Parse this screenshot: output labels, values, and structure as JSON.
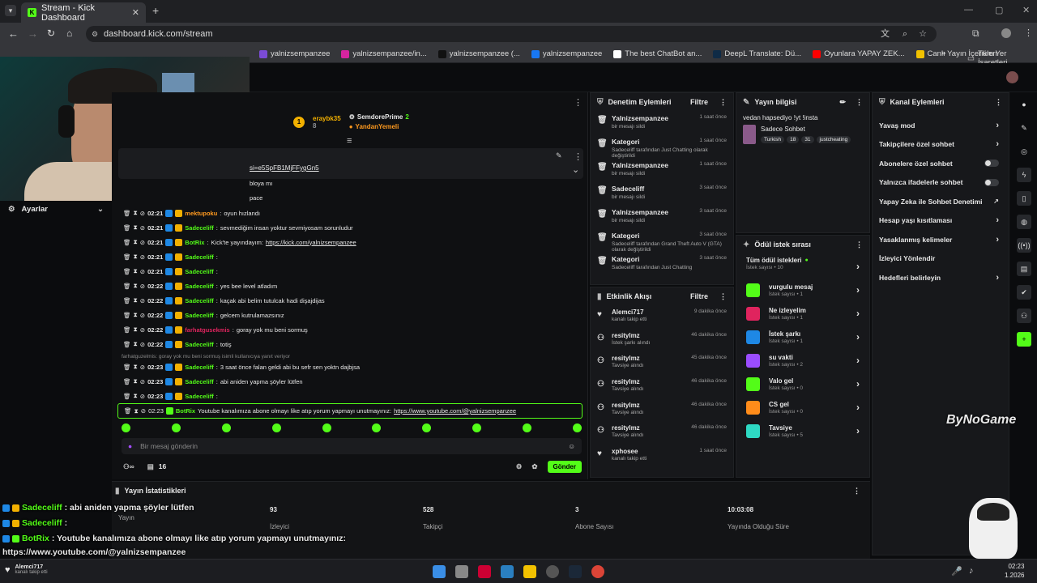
{
  "browser": {
    "tab_title": "Stream - Kick Dashboard",
    "url": "dashboard.kick.com/stream",
    "bookmarks": [
      {
        "label": "yalnizsempanzee",
        "color": "#7b4bd6"
      },
      {
        "label": "yalnizsempanzee/in...",
        "color": "#d6249f"
      },
      {
        "label": "yalnizsempanzee (...",
        "color": "#111111"
      },
      {
        "label": "yalnizsempanzee",
        "color": "#1877f2"
      },
      {
        "label": "The best ChatBot an...",
        "color": "#ffffff"
      },
      {
        "label": "DeepL Translate: Dü...",
        "color": "#0f2b46"
      },
      {
        "label": "Oyunlara YAPAY ZEK...",
        "color": "#ff0000"
      },
      {
        "label": "Canlı Yayın İçerikleri",
        "color": "#f2c200"
      }
    ],
    "bookmarks_more": "»",
    "all_bookmarks": "Tüm Yer İşaretleri"
  },
  "left": {
    "settings_label": "Ayarlar"
  },
  "chat": {
    "top_users": [
      {
        "name": "eraybk35",
        "count": "8"
      },
      {
        "name": "SemdorePrime",
        "count": "2"
      },
      {
        "name": "YandanYemeli",
        "count": ""
      }
    ],
    "pinned_link": "si=e5SpFB1MjFFygGn5",
    "partial_lines": [
      "bloya mı",
      "pace"
    ],
    "messages": [
      {
        "time": "02:21",
        "user": "mektupoku",
        "ucolor": "#ff9a1f",
        "text": "oyun hızlandı"
      },
      {
        "time": "02:21",
        "user": "Sadeceliff",
        "ucolor": "#53fc18",
        "text": "sevmediğim insan yoktur sevmiyosam sorunludur"
      },
      {
        "time": "02:21",
        "user": "BotRix",
        "ucolor": "#53fc18",
        "text": "Kick'te yayındayım: ",
        "link": "https://kick.com/yalnizsempanzee"
      },
      {
        "time": "02:21",
        "user": "Sadeceliff",
        "ucolor": "#53fc18",
        "text": ""
      },
      {
        "time": "02:21",
        "user": "Sadeceliff",
        "ucolor": "#53fc18",
        "text": ""
      },
      {
        "time": "02:22",
        "user": "Sadeceliff",
        "ucolor": "#53fc18",
        "text": "yes bee level atladım"
      },
      {
        "time": "02:22",
        "user": "Sadeceliff",
        "ucolor": "#53fc18",
        "text": "kaçak abi belim tutulcak hadi dişajdijas"
      },
      {
        "time": "02:22",
        "user": "Sadeceliff",
        "ucolor": "#53fc18",
        "text": "gelcem kutrulamazsınız"
      },
      {
        "time": "02:22",
        "user": "farhatgusekmis",
        "ucolor": "#e0245e",
        "text": "goray yok mu beni sormuş"
      },
      {
        "time": "02:22",
        "user": "Sadeceliff",
        "ucolor": "#53fc18",
        "text": "totiş"
      }
    ],
    "reply_note": "farhatguzelmis: goray yok mu beni sormuş isimli kullanıcıya yanıt veriyor",
    "messages2": [
      {
        "time": "02:23",
        "user": "Sadeceliff",
        "ucolor": "#53fc18",
        "text": "3 saat önce falan geldi abi bu sefr sen yoktn dajbjsa"
      },
      {
        "time": "02:23",
        "user": "Sadeceliff",
        "ucolor": "#53fc18",
        "text": "abi aniden yapma şöyler lütfen"
      },
      {
        "time": "02:23",
        "user": "Sadeceliff",
        "ucolor": "#53fc18",
        "text": ""
      }
    ],
    "highlight": {
      "time": "02:23",
      "user": "BotRix",
      "text": "Youtube kanalımıza abone olmayı like atıp yorum yapmayı unutmayınız: ",
      "link": "https://www.youtube.com/@yalnizsempanzee"
    },
    "input_placeholder": "Bir mesaj gönderin",
    "viewer_count": "16",
    "send_label": "Gönder"
  },
  "moderation": {
    "title": "Denetim Eylemleri",
    "filter": "Filtre",
    "items": [
      {
        "name": "Yalnizsempanzee",
        "time": "1 saat önce",
        "sub": "bir mesajı sildi"
      },
      {
        "name": "Kategori",
        "time": "1 saat önce",
        "sub": "Sadeceliff tarafından Just Chatting olarak değiştirildi"
      },
      {
        "name": "Yalnizsempanzee",
        "time": "1 saat önce",
        "sub": "bir mesajı sildi"
      },
      {
        "name": "Sadeceliff",
        "time": "3 saat önce",
        "sub": "bir mesajı sildi"
      },
      {
        "name": "Yalnizsempanzee",
        "time": "3 saat önce",
        "sub": "bir mesajı sildi"
      },
      {
        "name": "Kategori",
        "time": "3 saat önce",
        "sub": "Sadeceliff tarafından Grand Theft Auto V (GTA) olarak değiştirildi"
      },
      {
        "name": "Kategori",
        "time": "3 saat önce",
        "sub": "Sadeceliff tarafından Just Chatting"
      }
    ]
  },
  "activity": {
    "title": "Etkinlik Akışı",
    "filter": "Filtre",
    "items": [
      {
        "name": "Alemci717",
        "time": "9 dakika önce",
        "sub": "kanalı takip etti"
      },
      {
        "name": "resitylmz",
        "time": "46 dakika önce",
        "sub": "İstek şarkı alındı"
      },
      {
        "name": "resitylmz",
        "time": "45 dakika önce",
        "sub": "Tavsiye alındı"
      },
      {
        "name": "resitylmz",
        "time": "46 dakika önce",
        "sub": "Tavsiye alındı"
      },
      {
        "name": "resitylmz",
        "time": "46 dakika önce",
        "sub": "Tavsiye alındı"
      },
      {
        "name": "resitylmz",
        "time": "46 dakika önce",
        "sub": "Tavsiye alındı"
      },
      {
        "name": "xphosee",
        "time": "1 saat önce",
        "sub": "kanalı takip etti"
      }
    ]
  },
  "stream_info": {
    "title": "Yayın bilgisi",
    "stream_title": "vedan hapsediyo !yt !insta",
    "category": "Sadece Sohbet",
    "tags": [
      "Turkish",
      "18",
      "31",
      "justcheating"
    ]
  },
  "rewards": {
    "title": "Ödül istek sırası",
    "all_label": "Tüm ödül istekleri",
    "all_count": "İstek sayısı • 10",
    "items": [
      {
        "name": "vurgulu mesaj",
        "count": "İstek sayısı • 1",
        "color": "#53fc18"
      },
      {
        "name": "Ne izleyelim",
        "count": "İstek sayısı • 1",
        "color": "#e0245e"
      },
      {
        "name": "İstek şarkı",
        "count": "İstek sayısı • 1",
        "color": "#1e88e5"
      },
      {
        "name": "su vakti",
        "count": "İstek sayısı • 2",
        "color": "#9b4dff"
      },
      {
        "name": "Valo gel",
        "count": "İstek sayısı • 0",
        "color": "#53fc18"
      },
      {
        "name": "CS gel",
        "count": "İstek sayısı • 0",
        "color": "#ff8c1a"
      },
      {
        "name": "Tavsiye",
        "count": "İstek sayısı • 5",
        "color": "#2ed9c3"
      }
    ]
  },
  "channel": {
    "title": "Kanal Eylemleri",
    "items": [
      {
        "label": "Yavaş mod",
        "control": "chevron"
      },
      {
        "label": "Takipçilere özel sohbet",
        "control": "chevron"
      },
      {
        "label": "Abonelere özel sohbet",
        "control": "toggle"
      },
      {
        "label": "Yalnızca ifadelerle sohbet",
        "control": "toggle"
      },
      {
        "label": "Yapay Zeka ile Sohbet Denetimi",
        "control": "external"
      },
      {
        "label": "Hesap yaşı kısıtlaması",
        "control": "chevron"
      },
      {
        "label": "Yasaklanmış kelimeler",
        "control": "chevron"
      },
      {
        "label": "İzleyici Yönlendir",
        "control": "none"
      },
      {
        "label": "Hedefleri belirleyin",
        "control": "chevron"
      }
    ]
  },
  "stats": {
    "title": "Yayın İstatistikleri",
    "items": [
      {
        "value": "",
        "label": "Yayın"
      },
      {
        "value": "93",
        "label": "İzleyici"
      },
      {
        "value": "528",
        "label": "Takipçi"
      },
      {
        "value": "3",
        "label": "Abone Sayısı"
      },
      {
        "value": "10:03:08",
        "label": "Yayında Olduğu Süre"
      }
    ]
  },
  "overlay": {
    "lines": [
      {
        "user": "Sadeceliff",
        "text": ": abi aniden yapma şöyler lütfen"
      },
      {
        "user": "Sadeceliff",
        "text": ":"
      },
      {
        "user": "BotRix",
        "text": ": Youtube kanalımıza abone olmayı like atıp yorum yapmayı unutmayınız:"
      }
    ],
    "url_line": "https://www.youtube.com/@yalnizsempanzee",
    "watermark": "ByNoGame",
    "alert_name": "Alemci717",
    "alert_sub": "kanalı takip etti"
  },
  "taskbar": {
    "time": "02:23",
    "date": "1.2026"
  }
}
